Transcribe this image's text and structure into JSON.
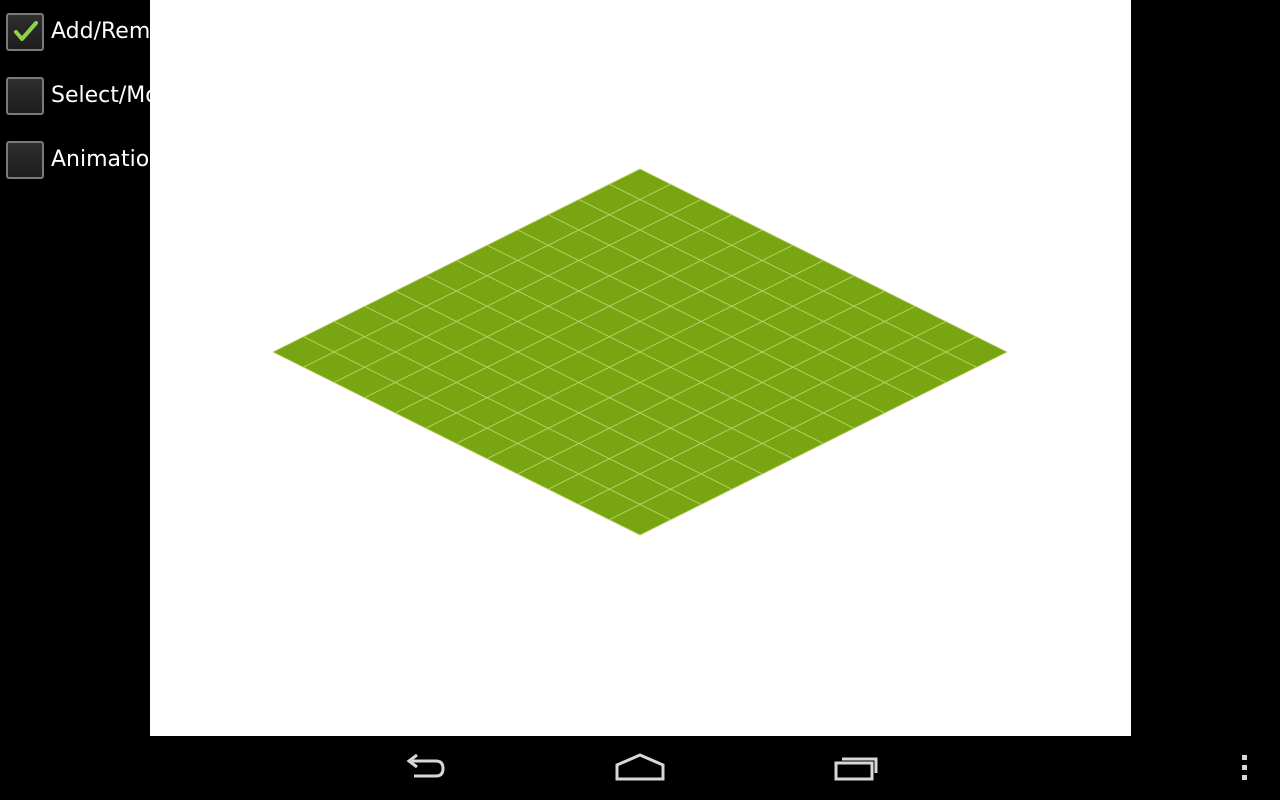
{
  "options": [
    {
      "label": "Add/Remove",
      "checked": true
    },
    {
      "label": "Select/Move",
      "checked": false
    },
    {
      "label": "Animation",
      "checked": false
    }
  ],
  "canvas": {
    "background": "#ffffff",
    "grid_size": 12,
    "tile_color": "#7aa512",
    "tile_line_color": "#b8d46a"
  },
  "colors": {
    "check_mark": "#8fd24a",
    "nav_icon": "#d8d8d8"
  },
  "nav": {
    "icons": [
      "back-icon",
      "home-icon",
      "recent-apps-icon",
      "overflow-menu-icon"
    ]
  }
}
